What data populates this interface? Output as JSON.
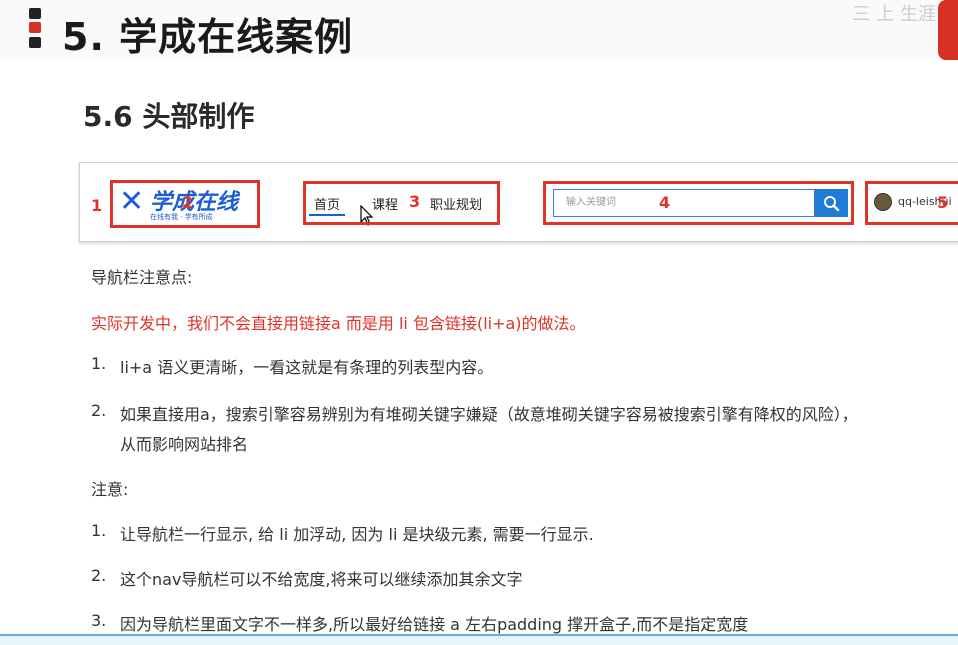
{
  "slide": {
    "title": "5. 学成在线案例",
    "subtitle": "5.6 头部制作",
    "corner_mark": "三 上 生涯"
  },
  "demo_header": {
    "logo_text": "学成在线",
    "logo_slogan": "在线有我 · 学有所成",
    "nav": [
      "首页",
      "课程",
      "职业规划"
    ],
    "search_placeholder": "输入关键词",
    "username": "qq-leishui",
    "annotation_numbers": [
      "1",
      "2",
      "3",
      "4",
      "5"
    ]
  },
  "notes": {
    "heading1": "导航栏注意点:",
    "warning": "实际开发中，我们不会直接用链接a 而是用 li  包含链接(li+a)的做法。",
    "list1": [
      {
        "num": "1.",
        "text": "li+a 语义更清晰，一看这就是有条理的列表型内容。"
      },
      {
        "num": "2.",
        "text": "如果直接用a，搜索引擎容易辨别为有堆砌关键字嫌疑（故意堆砌关键字容易被搜索引擎有降权的风险），",
        "text2": "从而影响网站排名"
      }
    ],
    "heading2": "注意:",
    "list2": [
      {
        "num": "1.",
        "text": "让导航栏一行显示, 给 li 加浮动, 因为 li 是块级元素, 需要一行显示."
      },
      {
        "num": "2.",
        "text": "这个nav导航栏可以不给宽度,将来可以继续添加其余文字"
      },
      {
        "num": "3.",
        "text": "因为导航栏里面文字不一样多,所以最好给链接 a 左右padding 撑开盒子,而不是指定宽度"
      }
    ]
  },
  "colors": {
    "accent_red": "#e0332a",
    "brand_blue": "#1e5cd6"
  }
}
